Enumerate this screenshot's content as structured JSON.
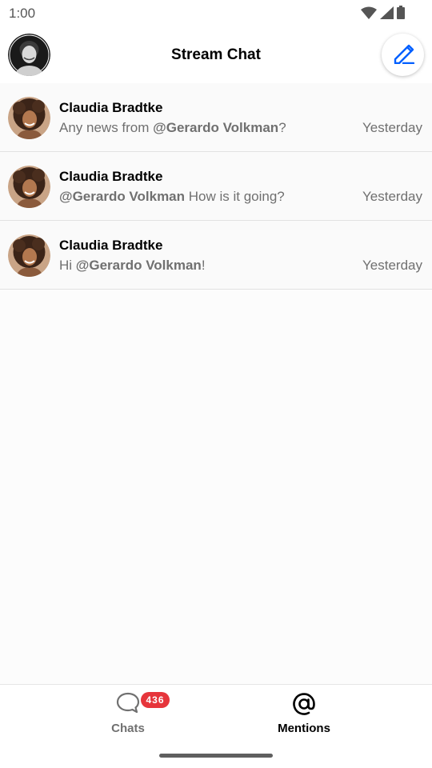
{
  "status_bar": {
    "time": "1:00",
    "icons": [
      "wifi-icon",
      "cellular-signal-icon",
      "battery-icon"
    ]
  },
  "header": {
    "title": "Stream Chat",
    "avatar_icon": "user-avatar",
    "compose_icon": "edit-pencil-icon",
    "accent_color": "#005fff"
  },
  "mentions": [
    {
      "name": "Claudia Bradtke",
      "prefix": "Any news from ",
      "mention": "@Gerardo Volkman",
      "suffix": "?",
      "time": "Yesterday"
    },
    {
      "name": "Claudia Bradtke",
      "prefix": "",
      "mention": "@Gerardo Volkman",
      "suffix": " How is it going?",
      "time": "Yesterday"
    },
    {
      "name": "Claudia Bradtke",
      "prefix": "Hi ",
      "mention": "@Gerardo Volkman",
      "suffix": "!",
      "time": "Yesterday"
    }
  ],
  "bottom_nav": {
    "tabs": [
      {
        "label": "Chats",
        "icon": "chat-bubble-icon",
        "badge": "436",
        "active": false
      },
      {
        "label": "Mentions",
        "icon": "at-sign-icon",
        "active": true
      }
    ],
    "badge_color": "#e6353b"
  }
}
